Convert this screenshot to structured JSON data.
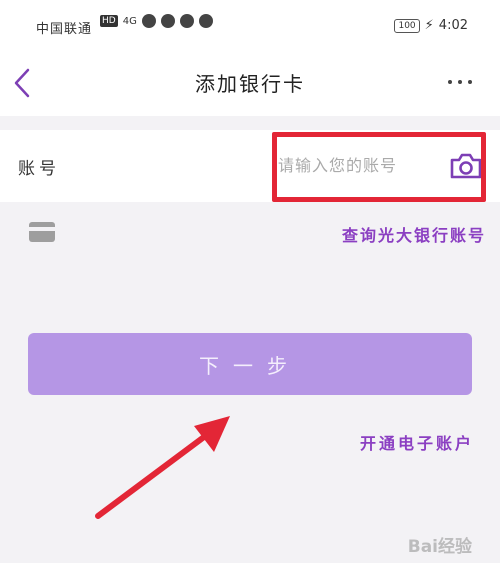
{
  "status_bar": {
    "carrier": "中国联通",
    "hd_badge": "HD",
    "signal": "4G",
    "battery": "100",
    "time": "4:02"
  },
  "nav": {
    "title": "添加银行卡",
    "back_icon": "chevron-left-icon",
    "more_icon": "more-horizontal-icon"
  },
  "form": {
    "account_label": "账号",
    "account_placeholder": "请输入您的账号",
    "account_value": "",
    "camera_icon": "camera-icon"
  },
  "links": {
    "query_account": "查询光大银行账号",
    "open_e_account": "开通电子账户"
  },
  "actions": {
    "next_label": "下一步"
  },
  "colors": {
    "accent": "#8b3fc2",
    "button_bg": "#b596e5",
    "highlight": "#e32636"
  },
  "watermark": "Bai经验"
}
